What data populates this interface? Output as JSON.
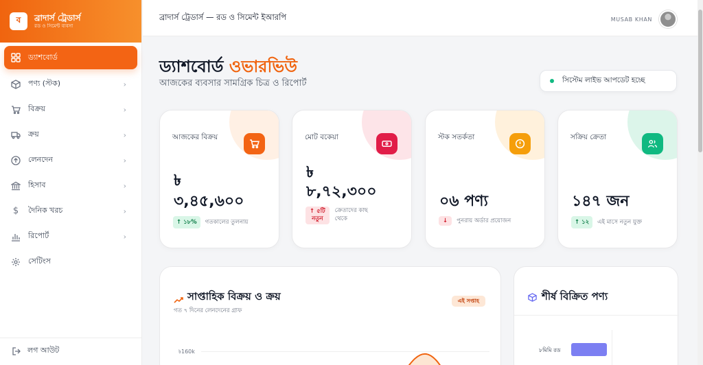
{
  "brand": {
    "logo_letter": "ব",
    "title": "ব্রাদার্স ট্রেডার্স",
    "subtitle": "রড ও সিমেন্ট ব্যবসা",
    "color": "#f0640f"
  },
  "sidebar": {
    "items": [
      {
        "label": "ড্যাশবোর্ড",
        "icon": "grid-icon",
        "active": true
      },
      {
        "label": "পণ্য (স্টক)",
        "icon": "box-icon"
      },
      {
        "label": "বিক্রয়",
        "icon": "cart-icon"
      },
      {
        "label": "ক্রয়",
        "icon": "truck-icon"
      },
      {
        "label": "লেনদেন",
        "icon": "arrow-circle-icon"
      },
      {
        "label": "হিসাব",
        "icon": "bank-icon"
      },
      {
        "label": "দৈনিক খরচ",
        "icon": "dollar-icon"
      },
      {
        "label": "রিপোর্ট",
        "icon": "bar-chart-icon"
      },
      {
        "label": "সেটিংস",
        "icon": "gear-icon"
      }
    ],
    "logout": "লগ আউট"
  },
  "topbar": {
    "title": "ব্রাদার্স ট্রেডার্স — রড ও সিমেন্ট ইআরপি",
    "user_name": "MUSAB KHAN"
  },
  "page": {
    "title_main": "ড্যাশবোর্ড",
    "title_accent": "ওভারভিউ",
    "subtitle": "আজকের ব্যবসার সামগ্রিক চিত্র ও রিপোর্ট",
    "live_status": "সিস্টেম লাইভ আপডেট হচ্ছে"
  },
  "cards": [
    {
      "label": "আজকের বিক্রয়",
      "value_line1": "৳",
      "value_line2": "৩,৪৫,৬০০",
      "badge": "↑ ১৮%",
      "note": "গতকালের তুলনায়",
      "icon": "cart-icon",
      "accent": "#f0640f"
    },
    {
      "label": "মোট বকেয়া",
      "value_line1": "৳",
      "value_line2": "৮,৭২,৩০০",
      "badge_line1": "↑ ৫টি",
      "badge_line2": "নতুন",
      "note_line1": "ক্রেতাদের কাছ",
      "note_line2": "থেকে",
      "icon": "wallet-icon",
      "accent": "#e11d48"
    },
    {
      "label": "স্টক সতর্কতা",
      "value": "০৬ পণ্য",
      "badge": "↓",
      "note": "পুনরায় অর্ডার প্রয়োজন",
      "icon": "alert-icon",
      "accent": "#f59e0b"
    },
    {
      "label": "সক্রিয় ক্রেতা",
      "value": "১৪৭ জন",
      "badge": "↑ ১২",
      "note": "এই মাসে নতুন যুক্ত",
      "icon": "users-icon",
      "accent": "#10b981"
    }
  ],
  "weekly_panel": {
    "title": "সাপ্তাহিক বিক্রয় ও ক্রয়",
    "subtitle": "গত ৭ দিনের লেনদেনের গ্রাফ",
    "pill": "এই সপ্তাহ",
    "y_tick": "৳160k"
  },
  "top_panel": {
    "title": "শীর্ষ বিক্রিত পণ্য",
    "item_label": "৮মিমি রড"
  }
}
